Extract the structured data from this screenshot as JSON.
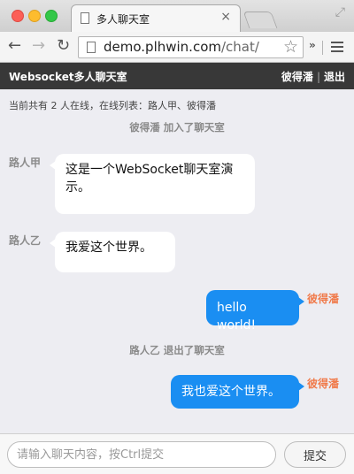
{
  "browser": {
    "tab_title": "多人聊天室",
    "tab_close": "×",
    "url_host": "demo.plhwin.com",
    "url_path": "/chat/",
    "star_glyph": "☆",
    "chevron_glyph": "»",
    "back_glyph": "←",
    "forward_glyph": "→",
    "reload_glyph": "↻",
    "fullscreen_glyph": "⤢"
  },
  "header": {
    "title": "Websocket多人聊天室",
    "current_user": "彼得潘",
    "separator": "|",
    "logout_label": "退出"
  },
  "chat": {
    "online_info": "当前共有 2 人在线，在线列表：路人甲、彼得潘",
    "system_messages": [
      "彼得潘 加入了聊天室",
      "路人乙 退出了聊天室"
    ],
    "messages": [
      {
        "sender": "路人甲",
        "text": "这是一个WebSocket聊天室演示。",
        "side": "left"
      },
      {
        "sender": "路人乙",
        "text": "我爱这个世界。",
        "side": "left"
      },
      {
        "sender": "彼得潘",
        "text": "hello world!",
        "side": "right"
      },
      {
        "sender": "彼得潘",
        "text": "我也爱这个世界。",
        "side": "right"
      }
    ]
  },
  "input": {
    "placeholder": "请输入聊天内容，按Ctrl提交",
    "send_label": "提交"
  },
  "colors": {
    "header_bg": "#383838",
    "own_bubble": "#1a8ef2",
    "own_name": "#f07a4a",
    "other_bubble": "#ffffff"
  }
}
